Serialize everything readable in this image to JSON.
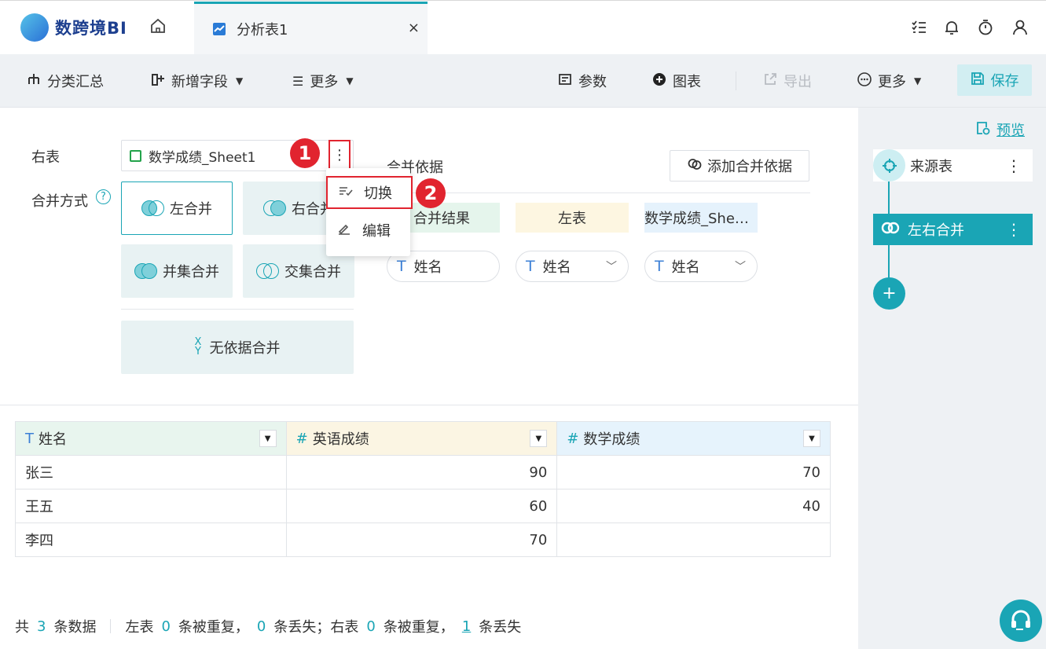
{
  "app": {
    "name": "数跨境BI"
  },
  "tabs": [
    {
      "label": "分析表1",
      "close": "×"
    }
  ],
  "toolbar": {
    "group_summary": "分类汇总",
    "add_field": "新增字段",
    "more_left": "更多",
    "params": "参数",
    "chart": "图表",
    "export": "导出",
    "more_right": "更多",
    "save": "保存"
  },
  "config": {
    "right_table_label": "右表",
    "right_table_value": "数学成绩_Sheet1",
    "join_method_label": "合并方式",
    "join_options": [
      "左合并",
      "右合并",
      "并集合并",
      "交集合并"
    ],
    "no_basis_join": "无依据合并"
  },
  "menu": {
    "switch": "切换",
    "edit": "编辑"
  },
  "annotations": {
    "badge1": "1",
    "badge2": "2"
  },
  "basis": {
    "title": "合并依据",
    "add_button": "添加合并依据",
    "headers": [
      "合并结果",
      "左表",
      "数学成绩_She…"
    ],
    "fields": [
      "姓名",
      "姓名",
      "姓名"
    ]
  },
  "table": {
    "columns": [
      {
        "type_icon": "T",
        "name": "姓名"
      },
      {
        "type_icon": "#",
        "name": "英语成绩"
      },
      {
        "type_icon": "#",
        "name": "数学成绩"
      }
    ],
    "rows": [
      [
        "张三",
        "90",
        "70"
      ],
      [
        "王五",
        "60",
        "40"
      ],
      [
        "李四",
        "70",
        ""
      ]
    ]
  },
  "footer": {
    "prefix": "共",
    "total": "3",
    "total_suffix": "条数据",
    "left_label": "左表",
    "left_dup": "0",
    "left_dup_suffix": "条被重复，",
    "left_lost": "0",
    "left_lost_suffix": "条丢失；右表",
    "right_dup": "0",
    "right_dup_suffix": "条被重复，",
    "right_lost": "1",
    "right_lost_suffix": "条丢失"
  },
  "sidepanel": {
    "preview": "预览",
    "source_node": "来源表",
    "join_node": "左右合并",
    "add": "+"
  },
  "colors": {
    "accent": "#1aa5b5",
    "highlight_red": "#e1242f"
  }
}
